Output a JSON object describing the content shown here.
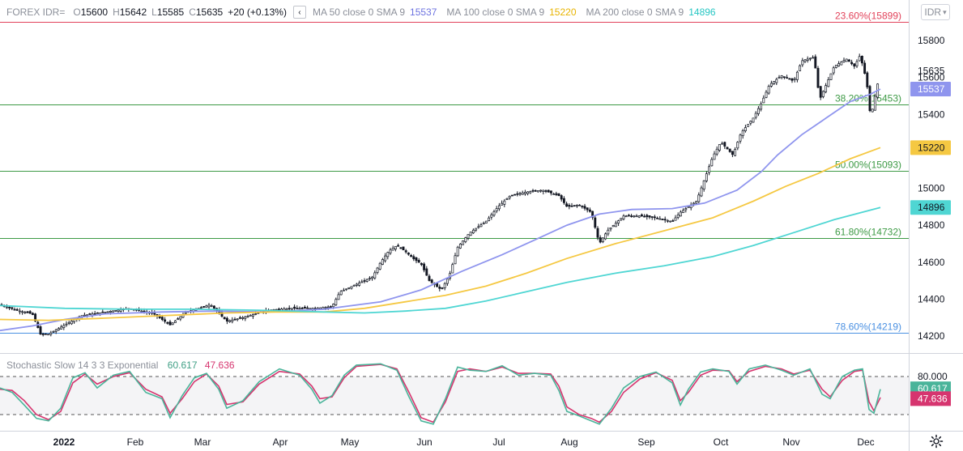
{
  "legend": {
    "symbol": "FOREX IDR=",
    "o_label": "O",
    "open": "15600",
    "h_label": "H",
    "high": "15642",
    "l_label": "L",
    "low": "15585",
    "c_label": "C",
    "close": "15635",
    "change": "+20 (+0.13%)",
    "collapse_glyph": "‹",
    "ma50_label": "MA 50 close 0 SMA 9",
    "ma50_value": "15537",
    "ma100_label": "MA 100 close 0 SMA 9",
    "ma100_value": "15220",
    "ma200_label": "MA 200 close 0 SMA 9",
    "ma200_value": "14896"
  },
  "symbol_box": "IDR",
  "stoch_legend": {
    "name": "Stochastic Slow 14 3 3 Exponential",
    "k_value": "60.617",
    "d_value": "47.636"
  },
  "colors": {
    "ma50": "#8f95ee",
    "ma100": "#f5c842",
    "ma200": "#4fd6d3",
    "stoch_k": "#4ab49a",
    "stoch_d": "#d6356f",
    "fib_red": "#e2425a",
    "fib_green": "#3d9a45",
    "fib_blue": "#4a90e2"
  },
  "chart_data": {
    "type": "candlestick",
    "price_axis": {
      "ticks": [
        "15800",
        "15600",
        "15400",
        "15200",
        "15000",
        "14800",
        "14600",
        "14400",
        "14200"
      ],
      "range": [
        14140,
        15920
      ]
    },
    "time_axis": [
      "2022",
      "Feb",
      "Mar",
      "Apr",
      "May",
      "Jun",
      "Jul",
      "Aug",
      "Sep",
      "Oct",
      "Nov",
      "Dec"
    ],
    "current_price_label": "15635",
    "fib_levels": [
      {
        "label": "23.60%(15899)",
        "value": 15899,
        "color": "red"
      },
      {
        "label": "38.20%(15453)",
        "value": 15453,
        "color": "green"
      },
      {
        "label": "50.00%(15093)",
        "value": 15093,
        "color": "green"
      },
      {
        "label": "61.80%(14732)",
        "value": 14732,
        "color": "green"
      },
      {
        "label": "78.60%(14219)",
        "value": 14219,
        "color": "blue"
      }
    ],
    "ma_series": [
      {
        "name": "MA 50",
        "value_label": "15537",
        "color": "ma50",
        "points": [
          [
            0,
            14230
          ],
          [
            40,
            14255
          ],
          [
            80,
            14290
          ],
          [
            130,
            14320
          ],
          [
            200,
            14330
          ],
          [
            260,
            14335
          ],
          [
            330,
            14330
          ],
          [
            400,
            14345
          ],
          [
            470,
            14385
          ],
          [
            520,
            14450
          ],
          [
            570,
            14550
          ],
          [
            620,
            14640
          ],
          [
            660,
            14720
          ],
          [
            700,
            14800
          ],
          [
            740,
            14860
          ],
          [
            780,
            14885
          ],
          [
            830,
            14890
          ],
          [
            870,
            14920
          ],
          [
            910,
            14990
          ],
          [
            940,
            15090
          ],
          [
            960,
            15180
          ],
          [
            990,
            15290
          ],
          [
            1020,
            15380
          ],
          [
            1050,
            15470
          ],
          [
            1075,
            15510
          ],
          [
            1087,
            15537
          ]
        ]
      },
      {
        "name": "MA 100",
        "value_label": "15220",
        "color": "ma100",
        "points": [
          [
            0,
            14290
          ],
          [
            60,
            14285
          ],
          [
            120,
            14295
          ],
          [
            200,
            14310
          ],
          [
            280,
            14325
          ],
          [
            340,
            14330
          ],
          [
            400,
            14330
          ],
          [
            450,
            14350
          ],
          [
            500,
            14385
          ],
          [
            550,
            14420
          ],
          [
            600,
            14470
          ],
          [
            650,
            14540
          ],
          [
            700,
            14620
          ],
          [
            760,
            14700
          ],
          [
            820,
            14770
          ],
          [
            880,
            14840
          ],
          [
            930,
            14930
          ],
          [
            970,
            15010
          ],
          [
            1010,
            15080
          ],
          [
            1050,
            15160
          ],
          [
            1087,
            15220
          ]
        ]
      },
      {
        "name": "MA 200",
        "value_label": "14896",
        "color": "ma200",
        "points": [
          [
            0,
            14365
          ],
          [
            80,
            14350
          ],
          [
            160,
            14345
          ],
          [
            240,
            14345
          ],
          [
            320,
            14340
          ],
          [
            400,
            14330
          ],
          [
            450,
            14325
          ],
          [
            500,
            14335
          ],
          [
            550,
            14350
          ],
          [
            600,
            14390
          ],
          [
            650,
            14440
          ],
          [
            700,
            14490
          ],
          [
            760,
            14540
          ],
          [
            820,
            14580
          ],
          [
            880,
            14630
          ],
          [
            930,
            14690
          ],
          [
            980,
            14760
          ],
          [
            1030,
            14830
          ],
          [
            1087,
            14896
          ]
        ]
      }
    ],
    "price_path": [
      [
        0,
        14370
      ],
      [
        20,
        14340
      ],
      [
        40,
        14320
      ],
      [
        50,
        14210
      ],
      [
        60,
        14210
      ],
      [
        80,
        14260
      ],
      [
        100,
        14310
      ],
      [
        130,
        14330
      ],
      [
        160,
        14350
      ],
      [
        190,
        14320
      ],
      [
        210,
        14260
      ],
      [
        230,
        14330
      ],
      [
        260,
        14370
      ],
      [
        280,
        14280
      ],
      [
        300,
        14300
      ],
      [
        330,
        14340
      ],
      [
        360,
        14350
      ],
      [
        390,
        14350
      ],
      [
        410,
        14360
      ],
      [
        420,
        14440
      ],
      [
        440,
        14480
      ],
      [
        460,
        14520
      ],
      [
        470,
        14600
      ],
      [
        480,
        14660
      ],
      [
        490,
        14690
      ],
      [
        500,
        14660
      ],
      [
        510,
        14620
      ],
      [
        520,
        14590
      ],
      [
        530,
        14500
      ],
      [
        545,
        14450
      ],
      [
        555,
        14530
      ],
      [
        565,
        14680
      ],
      [
        580,
        14760
      ],
      [
        600,
        14820
      ],
      [
        615,
        14900
      ],
      [
        630,
        14960
      ],
      [
        650,
        14980
      ],
      [
        670,
        14990
      ],
      [
        690,
        14960
      ],
      [
        700,
        14900
      ],
      [
        715,
        14910
      ],
      [
        730,
        14870
      ],
      [
        740,
        14700
      ],
      [
        750,
        14770
      ],
      [
        770,
        14850
      ],
      [
        790,
        14850
      ],
      [
        810,
        14840
      ],
      [
        830,
        14820
      ],
      [
        840,
        14870
      ],
      [
        860,
        14930
      ],
      [
        870,
        15050
      ],
      [
        880,
        15170
      ],
      [
        890,
        15250
      ],
      [
        905,
        15180
      ],
      [
        915,
        15300
      ],
      [
        930,
        15380
      ],
      [
        940,
        15460
      ],
      [
        950,
        15560
      ],
      [
        965,
        15610
      ],
      [
        980,
        15580
      ],
      [
        990,
        15690
      ],
      [
        1005,
        15710
      ],
      [
        1012,
        15480
      ],
      [
        1020,
        15560
      ],
      [
        1030,
        15660
      ],
      [
        1045,
        15700
      ],
      [
        1055,
        15660
      ],
      [
        1062,
        15720
      ],
      [
        1070,
        15580
      ],
      [
        1075,
        15380
      ],
      [
        1080,
        15490
      ],
      [
        1087,
        15635
      ]
    ],
    "stochastic": {
      "name": "Stochastic Slow 14 3 3 Exponential",
      "k_value": "60.617",
      "d_value": "47.636",
      "levels": [
        "80.000"
      ],
      "band": [
        20,
        80
      ],
      "k_path": [
        [
          0,
          62
        ],
        [
          15,
          55
        ],
        [
          30,
          35
        ],
        [
          45,
          14
        ],
        [
          60,
          10
        ],
        [
          75,
          30
        ],
        [
          90,
          78
        ],
        [
          105,
          86
        ],
        [
          120,
          62
        ],
        [
          140,
          82
        ],
        [
          160,
          88
        ],
        [
          180,
          55
        ],
        [
          200,
          45
        ],
        [
          210,
          15
        ],
        [
          225,
          50
        ],
        [
          240,
          78
        ],
        [
          255,
          85
        ],
        [
          270,
          60
        ],
        [
          280,
          30
        ],
        [
          300,
          42
        ],
        [
          320,
          72
        ],
        [
          345,
          92
        ],
        [
          370,
          82
        ],
        [
          385,
          60
        ],
        [
          395,
          38
        ],
        [
          410,
          50
        ],
        [
          425,
          82
        ],
        [
          440,
          98
        ],
        [
          470,
          100
        ],
        [
          490,
          90
        ],
        [
          505,
          48
        ],
        [
          520,
          10
        ],
        [
          535,
          5
        ],
        [
          550,
          45
        ],
        [
          565,
          95
        ],
        [
          580,
          90
        ],
        [
          600,
          88
        ],
        [
          620,
          97
        ],
        [
          640,
          82
        ],
        [
          660,
          85
        ],
        [
          680,
          82
        ],
        [
          690,
          58
        ],
        [
          700,
          25
        ],
        [
          715,
          18
        ],
        [
          730,
          10
        ],
        [
          740,
          5
        ],
        [
          755,
          30
        ],
        [
          770,
          62
        ],
        [
          790,
          80
        ],
        [
          810,
          87
        ],
        [
          830,
          70
        ],
        [
          840,
          35
        ],
        [
          850,
          60
        ],
        [
          865,
          87
        ],
        [
          880,
          92
        ],
        [
          900,
          88
        ],
        [
          910,
          68
        ],
        [
          925,
          92
        ],
        [
          945,
          98
        ],
        [
          965,
          90
        ],
        [
          980,
          82
        ],
        [
          1000,
          92
        ],
        [
          1015,
          52
        ],
        [
          1025,
          45
        ],
        [
          1040,
          80
        ],
        [
          1055,
          90
        ],
        [
          1065,
          92
        ],
        [
          1073,
          28
        ],
        [
          1079,
          22
        ],
        [
          1087,
          60
        ]
      ],
      "d_path": [
        [
          0,
          60
        ],
        [
          15,
          58
        ],
        [
          30,
          42
        ],
        [
          45,
          20
        ],
        [
          60,
          12
        ],
        [
          75,
          25
        ],
        [
          90,
          70
        ],
        [
          105,
          84
        ],
        [
          120,
          68
        ],
        [
          140,
          80
        ],
        [
          160,
          86
        ],
        [
          180,
          60
        ],
        [
          200,
          48
        ],
        [
          210,
          22
        ],
        [
          225,
          45
        ],
        [
          240,
          72
        ],
        [
          255,
          84
        ],
        [
          270,
          65
        ],
        [
          280,
          36
        ],
        [
          300,
          40
        ],
        [
          320,
          68
        ],
        [
          345,
          88
        ],
        [
          370,
          84
        ],
        [
          385,
          65
        ],
        [
          395,
          45
        ],
        [
          410,
          48
        ],
        [
          425,
          78
        ],
        [
          440,
          96
        ],
        [
          470,
          99
        ],
        [
          490,
          92
        ],
        [
          505,
          55
        ],
        [
          520,
          15
        ],
        [
          535,
          8
        ],
        [
          550,
          40
        ],
        [
          565,
          88
        ],
        [
          580,
          92
        ],
        [
          600,
          88
        ],
        [
          620,
          95
        ],
        [
          640,
          85
        ],
        [
          660,
          85
        ],
        [
          680,
          84
        ],
        [
          690,
          65
        ],
        [
          700,
          32
        ],
        [
          715,
          20
        ],
        [
          730,
          14
        ],
        [
          740,
          8
        ],
        [
          755,
          25
        ],
        [
          770,
          55
        ],
        [
          790,
          76
        ],
        [
          810,
          86
        ],
        [
          830,
          74
        ],
        [
          840,
          42
        ],
        [
          850,
          55
        ],
        [
          865,
          82
        ],
        [
          880,
          90
        ],
        [
          900,
          89
        ],
        [
          910,
          72
        ],
        [
          925,
          88
        ],
        [
          945,
          96
        ],
        [
          965,
          92
        ],
        [
          980,
          84
        ],
        [
          1000,
          90
        ],
        [
          1015,
          60
        ],
        [
          1025,
          48
        ],
        [
          1040,
          74
        ],
        [
          1055,
          88
        ],
        [
          1065,
          90
        ],
        [
          1073,
          40
        ],
        [
          1079,
          26
        ],
        [
          1087,
          47
        ]
      ]
    }
  }
}
